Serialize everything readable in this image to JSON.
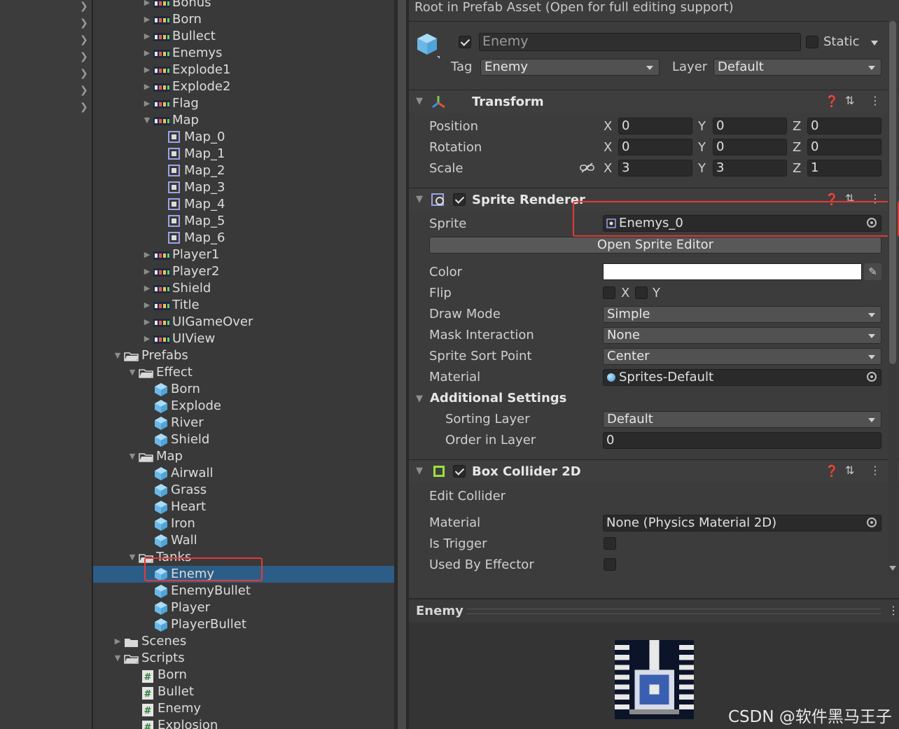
{
  "tree": {
    "rows": [
      {
        "label": "Bonus"
      },
      {
        "label": "Born"
      },
      {
        "label": "Bullect"
      },
      {
        "label": "Enemys"
      },
      {
        "label": "Explode1"
      },
      {
        "label": "Explode2"
      },
      {
        "label": "Flag"
      },
      {
        "label": "Map"
      },
      {
        "label": "Map_0"
      },
      {
        "label": "Map_1"
      },
      {
        "label": "Map_2"
      },
      {
        "label": "Map_3"
      },
      {
        "label": "Map_4"
      },
      {
        "label": "Map_5"
      },
      {
        "label": "Map_6"
      },
      {
        "label": "Player1"
      },
      {
        "label": "Player2"
      },
      {
        "label": "Shield"
      },
      {
        "label": "Title"
      },
      {
        "label": "UIGameOver"
      },
      {
        "label": "UIView"
      },
      {
        "label": "Prefabs"
      },
      {
        "label": "Effect"
      },
      {
        "label": "Born"
      },
      {
        "label": "Explode"
      },
      {
        "label": "River"
      },
      {
        "label": "Shield"
      },
      {
        "label": "Map"
      },
      {
        "label": "Airwall"
      },
      {
        "label": "Grass"
      },
      {
        "label": "Heart"
      },
      {
        "label": "Iron"
      },
      {
        "label": "Wall"
      },
      {
        "label": "Tanks"
      },
      {
        "label": "Enemy"
      },
      {
        "label": "EnemyBullet"
      },
      {
        "label": "Player"
      },
      {
        "label": "PlayerBullet"
      },
      {
        "label": "Scenes"
      },
      {
        "label": "Scripts"
      },
      {
        "label": "Born"
      },
      {
        "label": "Bullet"
      },
      {
        "label": "Enemy"
      },
      {
        "label": "Explosion"
      }
    ]
  },
  "inspector": {
    "header_notice": "Root in Prefab Asset (Open for full editing support)",
    "object": {
      "name": "Enemy",
      "static_label": "Static",
      "tag_label": "Tag",
      "tag_value": "Enemy",
      "layer_label": "Layer",
      "layer_value": "Default",
      "active": true,
      "static": false
    },
    "transform": {
      "title": "Transform",
      "position_label": "Position",
      "rotation_label": "Rotation",
      "scale_label": "Scale",
      "x": "X",
      "y": "Y",
      "z": "Z",
      "position": [
        "0",
        "0",
        "0"
      ],
      "rotation": [
        "0",
        "0",
        "0"
      ],
      "scale": [
        "3",
        "3",
        "1"
      ]
    },
    "sprite_renderer": {
      "title": "Sprite Renderer",
      "enabled": true,
      "sprite_label": "Sprite",
      "sprite_value": "Enemys_0",
      "open_editor": "Open Sprite Editor",
      "color_label": "Color",
      "color_value": "#ffffff",
      "flip_label": "Flip",
      "flip_x": "X",
      "flip_y": "Y",
      "draw_mode_label": "Draw Mode",
      "draw_mode_value": "Simple",
      "mask_label": "Mask Interaction",
      "mask_value": "None",
      "sort_point_label": "Sprite Sort Point",
      "sort_point_value": "Center",
      "material_label": "Material",
      "material_value": "Sprites-Default",
      "additional_label": "Additional Settings",
      "sorting_layer_label": "Sorting Layer",
      "sorting_layer_value": "Default",
      "order_label": "Order in Layer",
      "order_value": "0"
    },
    "box_collider": {
      "title": "Box Collider 2D",
      "enabled": true,
      "edit_collider": "Edit Collider",
      "material_label": "Material",
      "material_value": "None (Physics Material 2D)",
      "trigger_label": "Is Trigger",
      "effector_label": "Used By Effector"
    },
    "preview": {
      "title": "Enemy"
    }
  },
  "watermark": "CSDN @软件黑马王子",
  "colors": {
    "selection": "#2c5d87",
    "highlight_box": "#e53935",
    "prefab_cube": "#7cc3ef",
    "collider_icon": "#9be23c"
  }
}
